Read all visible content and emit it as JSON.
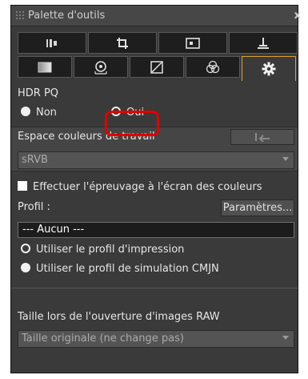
{
  "palette": {
    "title": "Palette d'outils",
    "close_glyph": "x",
    "tabs_row1": [
      {
        "icon": "tone-curve-bars-icon"
      },
      {
        "icon": "crop-icon"
      },
      {
        "icon": "image-frame-icon"
      },
      {
        "icon": "stamp-icon"
      }
    ],
    "tabs_row2": [
      {
        "icon": "picture-style-icon"
      },
      {
        "icon": "lens-aberration-icon"
      },
      {
        "icon": "tone-adjust-icon"
      },
      {
        "icon": "color-balance-icon"
      },
      {
        "icon": "settings-gear-icon",
        "active": true
      }
    ]
  },
  "hdr": {
    "heading": "HDR PQ",
    "option_non": "Non",
    "option_oui": "Oui",
    "selected": "Oui"
  },
  "workspace": {
    "label": "Espace couleurs de travail",
    "value": "sRVB",
    "apply_icon": "apply-arrow-icon"
  },
  "proofing": {
    "checkbox_label": "Effectuer l'épreuvage à l'écran des couleurs",
    "profile_label": "Profil :",
    "settings_button": "Paramètres...",
    "profile_value": "---  Aucun  ---",
    "option_print": "Utiliser le profil d'impression",
    "option_cmyk": "Utiliser le profil de simulation CMJN",
    "selected": "Utiliser le profil d'impression"
  },
  "raw_size": {
    "label": "Taille lors de l'ouverture d'images RAW",
    "value": "Taille originale (ne change pas)"
  },
  "colors": {
    "panel_bg": "#3a3a3a",
    "active_tab_border": "#e0a030",
    "highlight": "#e10000"
  }
}
